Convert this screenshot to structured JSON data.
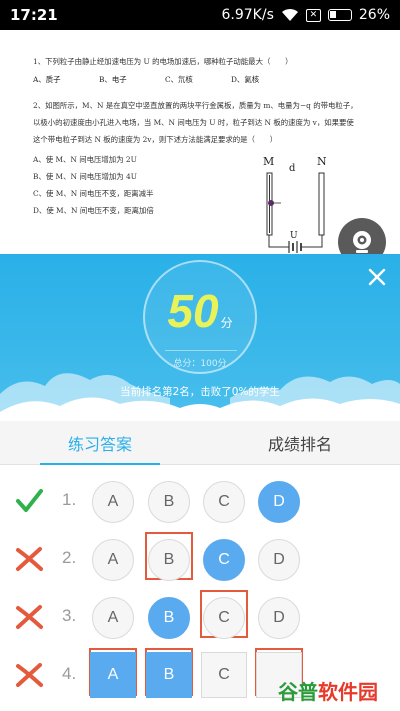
{
  "status_bar": {
    "time": "17:21",
    "speed": "6.97K/s",
    "battery": "26%"
  },
  "question": {
    "q1": "1、下列粒子由静止经加速电压为 U 的电场加速后，哪种粒子动能最大（　　）",
    "q1_options": [
      "A、质子",
      "B、电子",
      "C、氘核",
      "D、氦核"
    ],
    "q2_lines": [
      "2、如图所示，M、N 是在真空中竖直放置的两块平行金属板，质量为 m、电量为−q 的带电粒子，",
      "以极小的初速度由小孔进入电场，当 M、N 间电压为 U 时，粒子到达 N 板的速度为 v，如果要使",
      "这个带电粒子到达 N 板的速度为 2v，则下述方法能满足要求的是（　　）"
    ],
    "q2_options": [
      "A、使 M、N 间电压增加为 2U",
      "B、使 M、N 间电压增加为 4U",
      "C、使 M、N 间电压不变，距离减半",
      "D、使 M、N 间电压不变，距离加倍"
    ],
    "figure_labels": {
      "m": "M",
      "d": "d",
      "n": "N",
      "u": "U"
    }
  },
  "result": {
    "score": "50",
    "score_unit": "分",
    "total": "总分：100分",
    "rank_text": "当前排名第2名，击败了0%的学生"
  },
  "tabs": [
    "练习答案",
    "成绩排名"
  ],
  "answers": [
    {
      "num": "1.",
      "status": "correct",
      "options": [
        "A",
        "B",
        "C",
        "D"
      ]
    },
    {
      "num": "2.",
      "status": "wrong",
      "options": [
        "A",
        "B",
        "C",
        "D"
      ]
    },
    {
      "num": "3.",
      "status": "wrong",
      "options": [
        "A",
        "B",
        "C",
        "D"
      ]
    },
    {
      "num": "4.",
      "status": "wrong",
      "options": [
        "A",
        "B",
        "C",
        "D"
      ]
    }
  ],
  "watermark": "谷普软件园",
  "colors": {
    "accent": "#2ab0e8",
    "selected": "#5aaaf0",
    "wrong": "#e45a3c",
    "correct": "#2fb24a",
    "score": "#eaf25a"
  }
}
